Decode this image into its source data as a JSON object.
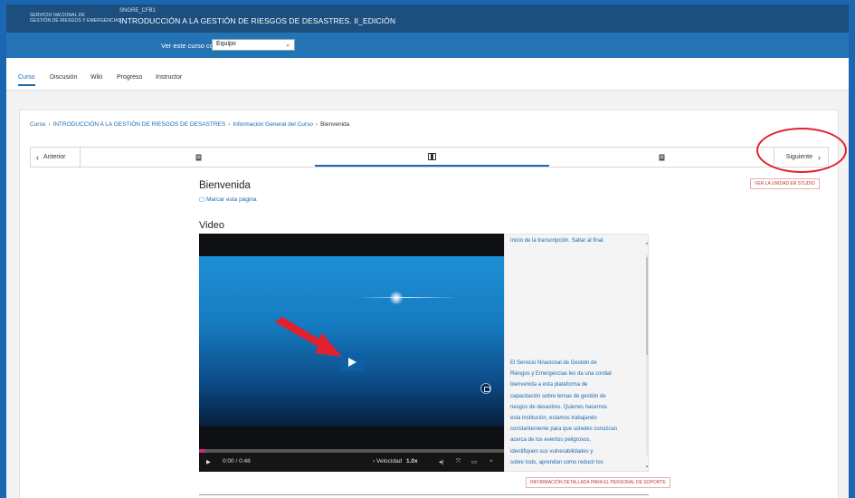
{
  "header": {
    "org_line1": "SERVICIO NACIONAL DE",
    "org_line2": "GESTIÓN DE RIESGOS Y EMERGENCIAS",
    "course_code": "SNGRE_CFB1",
    "course_title": "INTRODUCCIÓN A LA GESTIÓN DE RIESGOS DE DESASTRES. II_EDICIÓN"
  },
  "view_as": {
    "label": "Ver este curso como:",
    "selected": "Equipo"
  },
  "tabs": [
    {
      "label": "Curso"
    },
    {
      "label": "Discusión"
    },
    {
      "label": "Wiki"
    },
    {
      "label": "Progreso"
    },
    {
      "label": "Instructor"
    }
  ],
  "breadcrumb": {
    "items": [
      "Curso",
      "INTRODUCCIÓN A LA GESTIÓN DE RIESGOS DE DESASTRES",
      "Información General del Curso"
    ],
    "current": "Bienvenida",
    "separator": "›"
  },
  "sequence": {
    "prev_label": "Anterior",
    "next_label": "Siguiente",
    "tabs": [
      {
        "icon": "document-icon"
      },
      {
        "icon": "film-icon"
      },
      {
        "icon": "document-icon"
      }
    ]
  },
  "unit": {
    "title": "Bienvenida",
    "bookmark_label": "Marcar esta página",
    "studio_link": "VER LA UNIDAD EN STUDIO",
    "section_title": "Video"
  },
  "video": {
    "time": "0:00 / 0:48",
    "speed_label": "Velocidad",
    "speed_value": "1.0x",
    "progress_fraction": 0.02
  },
  "transcript": {
    "top_text": "Inicio de la transcripción. Saltar al final.",
    "lines": [
      "El Servicio Nnacional de Gestión de",
      "Riesgos y Emergencias les da una cordial",
      "bienvenida a esta plataforma de",
      "capacitación sobre temas de gestión de",
      "riesgos de desastres. Quienes hacemos",
      "esta institución, estamos trabajando",
      "constantemente para que ustedes conozcan",
      "acerca de los eventos peligrosos,",
      "identifiquen sus vulnerabilidades y",
      "sobre todo, aprendan como reducir los"
    ]
  },
  "support_link": "INFORMACIÓN DETALLADA PARA EL PERSONAL DE SOPORTE",
  "colors": {
    "header_dark": "#1c4f7e",
    "header_mid": "#2474b5",
    "link_blue": "#1a6ab0",
    "annotation_red": "#e3202e"
  }
}
